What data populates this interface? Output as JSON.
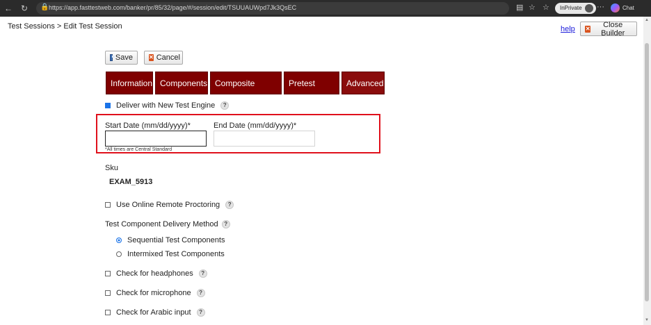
{
  "browser": {
    "url": "https://app.fasttestweb.com/banker/pr/85/32/page/#/session/edit/TSUUAUWpd7Jk3QsEC",
    "inprivate_label": "InPrivate",
    "chat_label": "Chat"
  },
  "header": {
    "breadcrumb": "Test Sessions  >  Edit Test Session",
    "help_label": "help",
    "close_builder_label": "Close Builder"
  },
  "toolbar": {
    "save_label": "Save",
    "cancel_label": "Cancel"
  },
  "tabs": [
    {
      "label": "Information",
      "active": false
    },
    {
      "label": "Components",
      "active": false
    },
    {
      "label": "Composite Scores",
      "active": false
    },
    {
      "label": "Pretest Screen",
      "active": false
    },
    {
      "label": "Advanced",
      "active": true
    }
  ],
  "form": {
    "deliver_new_engine": {
      "label": "Deliver with New Test Engine",
      "checked": true
    },
    "start_date": {
      "label": "Start Date (mm/dd/yyyy)*",
      "value": ""
    },
    "end_date": {
      "label": "End Date (mm/dd/yyyy)*",
      "value": ""
    },
    "timezone_note": "*All times are Central Standard",
    "sku": {
      "label": "Sku",
      "value": "EXAM_5913"
    },
    "remote_proctoring": {
      "label": "Use Online Remote Proctoring",
      "checked": false
    },
    "delivery_method": {
      "label": "Test Component Delivery Method",
      "options": [
        {
          "label": "Sequential Test Components",
          "selected": true
        },
        {
          "label": "Intermixed Test Components",
          "selected": false
        }
      ]
    },
    "headphones": {
      "label": "Check for headphones",
      "checked": false
    },
    "microphone": {
      "label": "Check for microphone",
      "checked": false
    },
    "arabic_input": {
      "label": "Check for Arabic input",
      "checked": false
    }
  },
  "help_glyph": "?",
  "colors": {
    "tab_bg": "#7f0000",
    "highlight": "#e0101b",
    "link": "#1a1adb"
  }
}
